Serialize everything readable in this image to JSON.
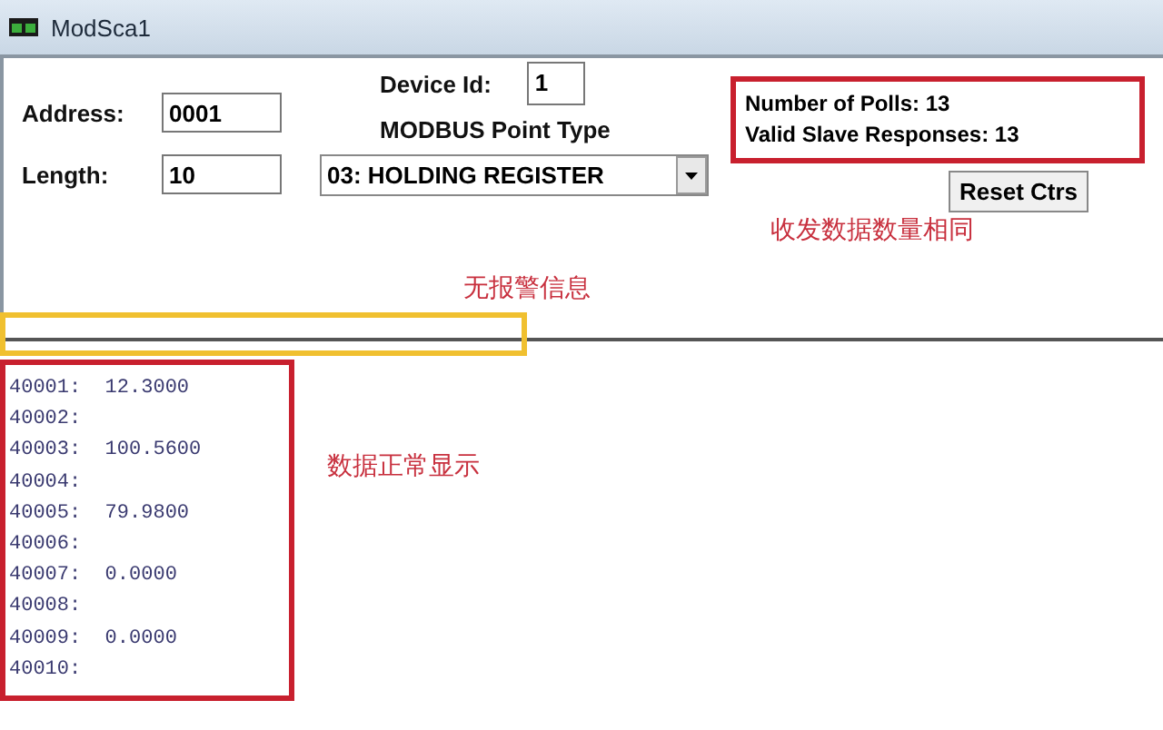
{
  "window": {
    "title": "ModSca1"
  },
  "address": {
    "label": "Address:",
    "value": "0001"
  },
  "length": {
    "label": "Length:",
    "value": "10"
  },
  "device_id": {
    "label": "Device Id:",
    "value": "1"
  },
  "point_type": {
    "label": "MODBUS Point Type",
    "value": "03: HOLDING REGISTER"
  },
  "counters": [
    "Number of Polls: 13",
    "Valid Slave Responses: 13"
  ],
  "reset_button": "Reset Ctrs",
  "annotations": {
    "counters_note": "收发数据数量相同",
    "status_note": "无报警信息",
    "data_note": "数据正常显示"
  },
  "data_rows": [
    {
      "address": "40001:",
      "value": "12.3000"
    },
    {
      "address": "40002:"
    },
    {
      "address": "40003:",
      "value": "100.5600"
    },
    {
      "address": "40004:"
    },
    {
      "address": "40005:",
      "value": "79.9800"
    },
    {
      "address": "40006:"
    },
    {
      "address": "40007:",
      "value": "0.0000"
    },
    {
      "address": "40008:"
    },
    {
      "address": "40009:",
      "value": "0.0000"
    },
    {
      "address": "40010:"
    }
  ]
}
